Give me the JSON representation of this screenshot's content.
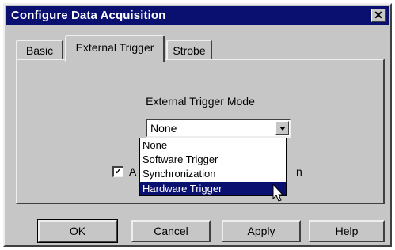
{
  "window": {
    "title": "Configure Data Acquisition",
    "close_glyph": "✕"
  },
  "tabs": [
    {
      "label": "Basic",
      "active": false
    },
    {
      "label": "External Trigger",
      "active": true
    },
    {
      "label": "Strobe",
      "active": false
    }
  ],
  "panel": {
    "mode_label": "External Trigger Mode",
    "combo_value": "None",
    "checkbox_checked": true,
    "checkbox_glyph": "✓",
    "checkbox_label_visible": "A",
    "checkbox_label_tail": "n"
  },
  "dropdown": {
    "options": [
      "None",
      "Software Trigger",
      "Synchronization",
      "Hardware Trigger"
    ],
    "highlighted": "Hardware Trigger"
  },
  "buttons": {
    "ok": "OK",
    "cancel": "Cancel",
    "apply": "Apply",
    "help": "Help"
  },
  "colors": {
    "titlebar": "#0a1070",
    "face": "#c6c6c6",
    "highlight": "#0a1070"
  }
}
